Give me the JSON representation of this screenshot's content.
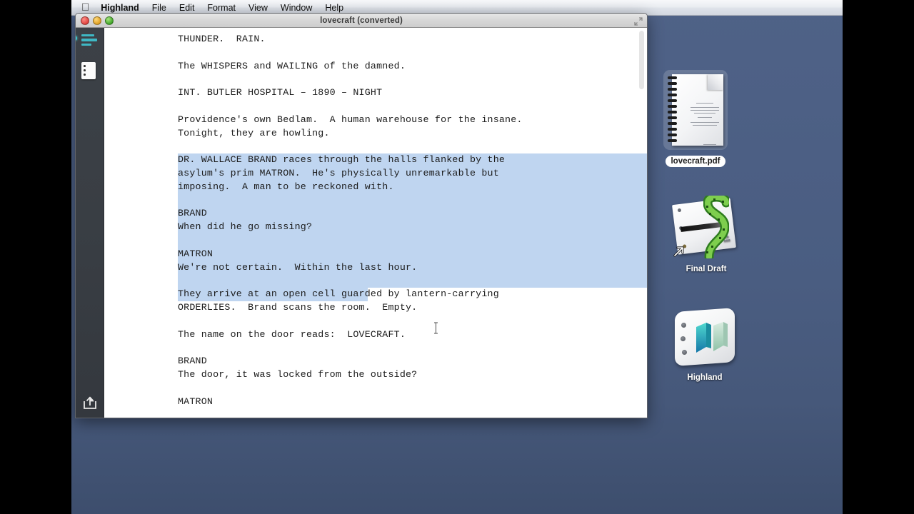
{
  "menubar": {
    "apple_glyph": "",
    "app_name": "Highland",
    "items": [
      "File",
      "Edit",
      "Format",
      "View",
      "Window",
      "Help"
    ]
  },
  "window": {
    "title": "lovecraft (converted)",
    "controls": {
      "close": "close",
      "minimize": "minimize",
      "zoom": "zoom",
      "fullscreen": "fullscreen"
    }
  },
  "sidebar": {
    "items": [
      {
        "name": "outline-icon",
        "label": "Outline"
      },
      {
        "name": "pages-icon",
        "label": "Pages"
      }
    ],
    "share_label": "Share"
  },
  "editor": {
    "scrollbar": "vertical-scrollbar",
    "selection_color": "#bfd5f0",
    "lines": [
      {
        "text": "THUNDER.  RAIN.",
        "selected": false
      },
      {
        "text": "",
        "selected": false
      },
      {
        "text": "The WHISPERS and WAILING of the damned.",
        "selected": false
      },
      {
        "text": "",
        "selected": false
      },
      {
        "text": "INT. BUTLER HOSPITAL – 1890 – NIGHT",
        "selected": false
      },
      {
        "text": "",
        "selected": false
      },
      {
        "text": "Providence's own Bedlam.  A human warehouse for the insane.",
        "selected": false
      },
      {
        "text": "Tonight, they are howling.",
        "selected": false
      },
      {
        "text": "",
        "selected": false
      },
      {
        "text": "DR. WALLACE BRAND races through the halls flanked by the",
        "selected": true
      },
      {
        "text": "asylum's prim MATRON.  He's physically unremarkable but",
        "selected": true
      },
      {
        "text": "imposing.  A man to be reckoned with.",
        "selected": true
      },
      {
        "text": "",
        "selected": true
      },
      {
        "text": "BRAND",
        "selected": true
      },
      {
        "text": "When did he go missing?",
        "selected": true
      },
      {
        "text": "",
        "selected": true
      },
      {
        "text": "MATRON",
        "selected": true
      },
      {
        "text": "We're not certain.  Within the last hour.",
        "selected": true
      },
      {
        "text": "",
        "selected": true
      },
      {
        "text": "They arrive at an open cell guarded by lantern-carrying",
        "selected": "partial"
      },
      {
        "text": "ORDERLIES.  Brand scans the room.  Empty.",
        "selected": false
      },
      {
        "text": "",
        "selected": false
      },
      {
        "text": "The name on the door reads:  LOVECRAFT.",
        "selected": false
      },
      {
        "text": "",
        "selected": false
      },
      {
        "text": "BRAND",
        "selected": false
      },
      {
        "text": "The door, it was locked from the outside?",
        "selected": false
      },
      {
        "text": "",
        "selected": false
      },
      {
        "text": "MATRON",
        "selected": false
      }
    ]
  },
  "desktop": {
    "icons": [
      {
        "name": "lovecraft-pdf",
        "label": "lovecraft.pdf",
        "selected": true
      },
      {
        "name": "final-draft-app",
        "label": "Final Draft",
        "selected": false
      },
      {
        "name": "highland-app",
        "label": "Highland",
        "selected": false
      }
    ]
  }
}
